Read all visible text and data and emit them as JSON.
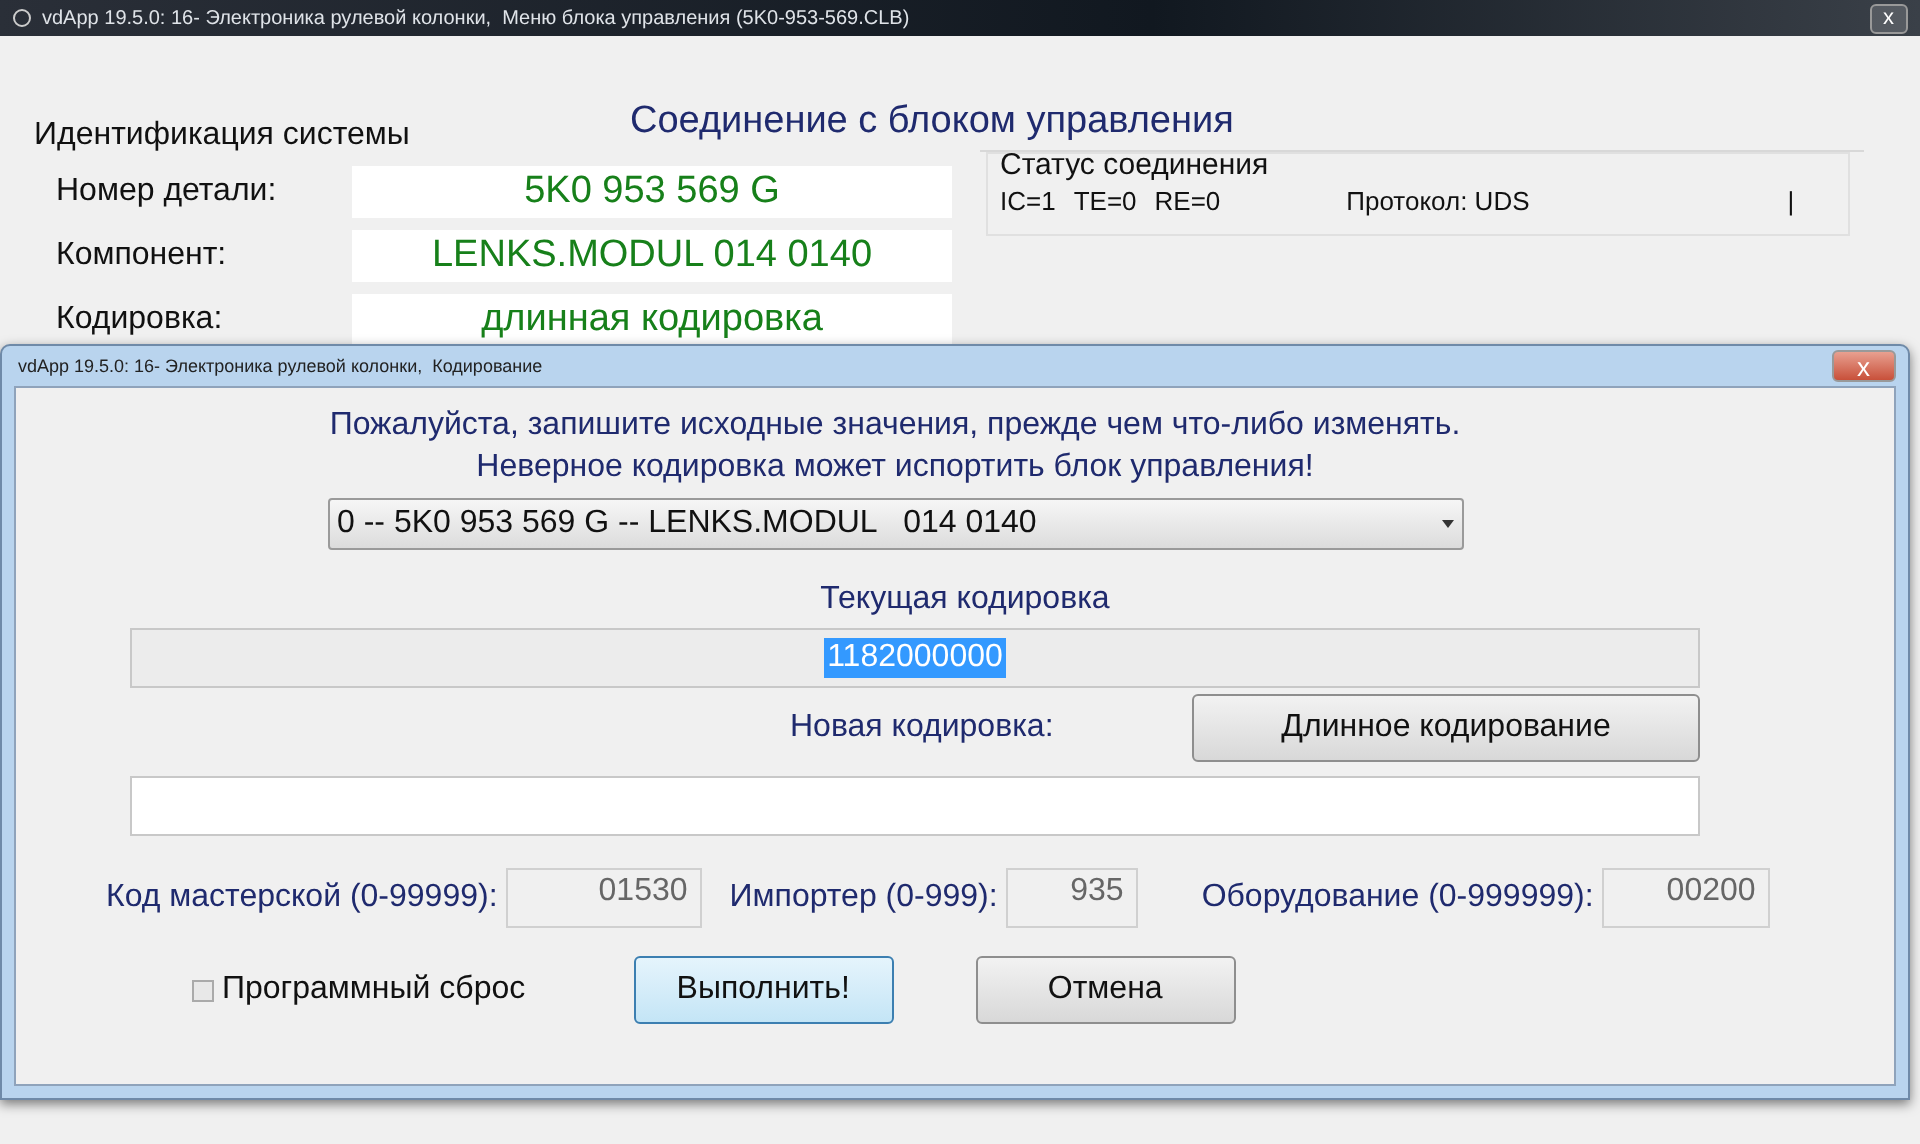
{
  "main_window": {
    "title": "vdApp 19.5.0: 16- Электроника рулевой колонки,  Меню блока управления (5K0-953-569.CLB)",
    "close": "x",
    "heading": "Соединение с блоком управления",
    "identification": {
      "title": "Идентификация системы",
      "rows": [
        {
          "label": "Номер детали:",
          "value": "5K0 953 569 G"
        },
        {
          "label": "Компонент:",
          "value": "LENKS.MODUL   014 0140"
        },
        {
          "label": "Кодировка:",
          "value": "длинная кодировка"
        }
      ]
    },
    "status": {
      "title": "Статус соединения",
      "counters": [
        "IC=1",
        "TE=0",
        "RE=0"
      ],
      "protocol": "Протокол: UDS",
      "cursor": "|"
    }
  },
  "dialog": {
    "title": "vdApp 19.5.0: 16- Электроника рулевой колонки,  Кодирование",
    "close": "x",
    "warnings": [
      "Пожалуйста, запишите исходные значения, прежде чем что-либо изменять.",
      "Неверное кодировка может испортить блок управления!"
    ],
    "module_select": {
      "value": "0 -- 5K0 953 569 G -- LENKS.MODUL   014 0140"
    },
    "current_coding": {
      "label": "Текущая кодировка",
      "value": "1182000000",
      "selected": true
    },
    "new_coding": {
      "label": "Новая кодировка:",
      "button": "Длинное кодирование"
    },
    "params": [
      {
        "label": "Код мастерской (0-99999):",
        "value": "01530"
      },
      {
        "label": "Импортер (0-999):",
        "value": "935"
      },
      {
        "label": "Оборудование (0-999999):",
        "value": "00200"
      }
    ],
    "software_reset": {
      "label": "Программный сброс",
      "checked": false
    },
    "buttons": [
      {
        "label": "Выполнить!",
        "focused": true
      },
      {
        "label": "Отмена",
        "focused": false
      }
    ]
  }
}
